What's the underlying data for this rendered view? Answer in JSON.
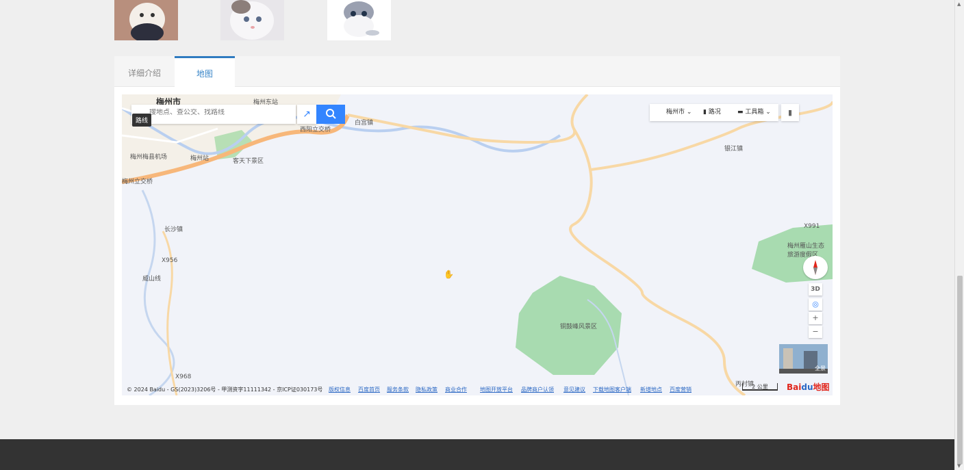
{
  "tabs": {
    "detail_label": "详细介绍",
    "map_label": "地图"
  },
  "map": {
    "search_placeholder": "搜地点、查公交、找路线",
    "route_tooltip": "路线",
    "city_select": "梅州市",
    "traffic_label": "路况",
    "toolbox_label": "工具箱",
    "labels": {
      "meizhou_city": "梅州市",
      "meizhou_east_station": "梅州东站",
      "xiyang_interchange": "西阳立交桥",
      "baigong_town": "白宫镇",
      "meixian_airport": "梅州梅县机场",
      "meizhou_station": "梅州站",
      "kejia_scenic": "客天下景区",
      "meizhou_interchange": "梅州立交桥",
      "changsha_town": "长沙镇",
      "yinjiang_town": "银江镇",
      "yanshan_line": "威山线",
      "yanshan_ecotourism": "梅州雁山生态旅游度假区",
      "tonggufeng_scenic": "铜鼓峰风景区",
      "bingcun_town": "丙村镇",
      "road_x956": "X956",
      "road_x968": "X968",
      "road_x991": "X991"
    },
    "controls": {
      "three_d": "3D",
      "zoom_in": "+",
      "zoom_out": "−"
    },
    "panorama_label": "全景",
    "scale_label": "2 公里",
    "logo_text": "Bai",
    "logo_paw": "du",
    "logo_sub": "地图",
    "copyright": "© 2024 Baidu - GS(2023)3206号 - 甲测资字11111342 - 京ICP证030173号",
    "footer_links": [
      "版权信息",
      "百度首页",
      "服务条款",
      "隐私政策",
      "商业合作",
      "地图开放平台",
      "品牌商户认领",
      "意见建议",
      "下载地图客户端",
      "新增地点",
      "百度营销"
    ]
  }
}
